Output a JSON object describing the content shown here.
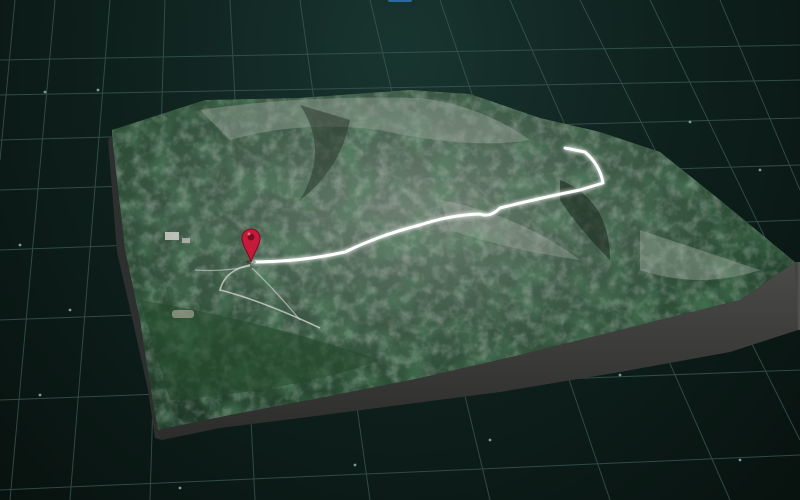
{
  "scene": {
    "type": "3d-terrain-map",
    "view": "satellite-terrain",
    "background_color": "#0f221e",
    "grid_color": "#3d5a54",
    "route_color": "#ffffff",
    "marker_color": "#c41b3a",
    "route": {
      "visible": true,
      "style": "glowing-line"
    },
    "marker": {
      "icon": "location-pin-icon"
    }
  }
}
